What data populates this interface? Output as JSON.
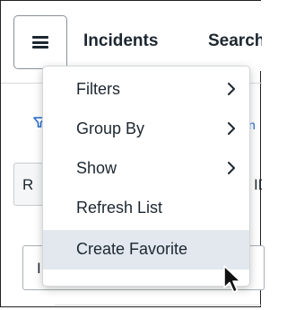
{
  "header": {
    "title": "Incidents",
    "search_partial": "Search"
  },
  "background": {
    "link_partial": "n",
    "row_button_label": "R",
    "row_right_partial": "ID",
    "input_partial": "I"
  },
  "menu": {
    "items": [
      {
        "label": "Filters",
        "has_submenu": true
      },
      {
        "label": "Group By",
        "has_submenu": true
      },
      {
        "label": "Show",
        "has_submenu": true
      },
      {
        "label": "Refresh List",
        "has_submenu": false
      },
      {
        "label": "Create Favorite",
        "has_submenu": false,
        "highlighted": true
      }
    ]
  },
  "colors": {
    "menu_highlight": "#e2e8ee",
    "link_blue": "#1f6bd1",
    "text": "#1d2730"
  }
}
